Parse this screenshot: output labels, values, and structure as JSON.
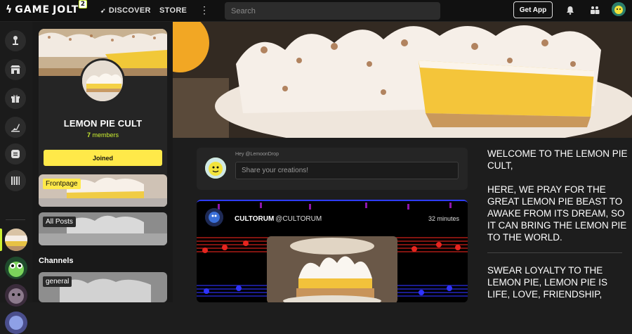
{
  "brand": {
    "logo_game": "GAME",
    "logo_jolt": "JOLT",
    "badge": "2"
  },
  "nav": {
    "discover": "DISCOVER",
    "store": "STORE",
    "search_placeholder": "Search",
    "get_app": "Get App"
  },
  "community": {
    "name": "LEMON PIE CULT",
    "member_count": "7",
    "members_label": "members",
    "joined_label": "Joined"
  },
  "channels": {
    "frontpage": "Frontpage",
    "all_posts": "All Posts",
    "heading": "Channels",
    "general": "general"
  },
  "compose": {
    "hint": "Hey @LemoonDrop",
    "placeholder": "Share your creations!"
  },
  "post": {
    "author": "CULTORUM",
    "handle": "@CULTORUM",
    "time": "32 minutes"
  },
  "description": {
    "p1": "WELCOME TO THE LEMON PIE CULT,",
    "p2": "HERE, WE PRAY FOR THE GREAT LEMON PIE BEAST TO AWAKE FROM ITS DREAM, SO IT CAN BRING THE LEMON PIE TO THE WORLD.",
    "p3": "SWEAR LOYALTY TO THE LEMON PIE, LEMON PIE IS LIFE, LOVE, FRIENDSHIP,"
  },
  "colors": {
    "accent": "#ccf030",
    "button_yellow": "#ffe949"
  }
}
